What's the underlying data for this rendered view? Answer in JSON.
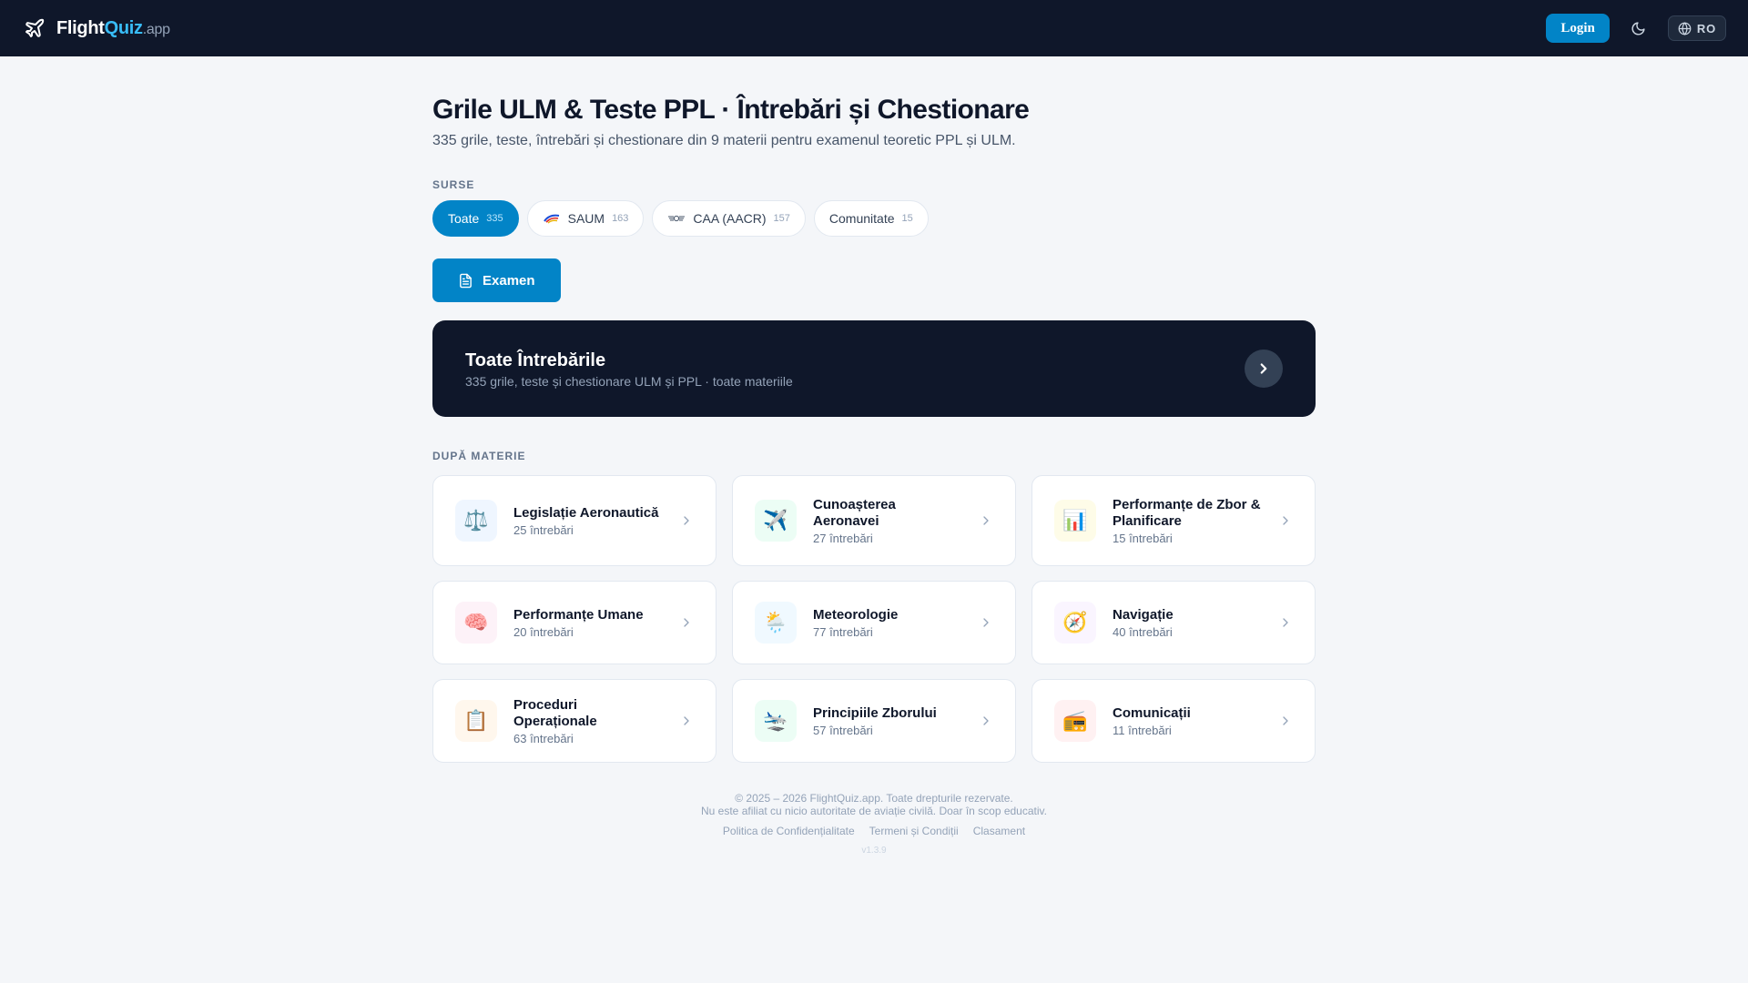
{
  "header": {
    "brand": {
      "part1": "Flight",
      "part2": "Quiz",
      "part3": ".app"
    },
    "login_label": "Login",
    "theme_icon": "moon-icon",
    "lang_label": "RO",
    "colors": {
      "bg": "#0f172a",
      "accent": "#38bdf8",
      "button": "#0284c7"
    }
  },
  "main": {
    "title": "Grile ULM & Teste PPL · Întrebări și Chestionare",
    "subtitle": "335 grile, teste, întrebări și chestionare din 9 materii pentru examenul teoretic PPL și ULM.",
    "sources_label": "SURSE",
    "sources": [
      {
        "label": "Toate",
        "count": "335",
        "active": true
      },
      {
        "label": "SAUM",
        "count": "163",
        "icon": "saum-logo"
      },
      {
        "label": "CAA (AACR)",
        "count": "157",
        "icon": "caa-wings-logo"
      },
      {
        "label": "Comunitate",
        "count": "15"
      }
    ],
    "exam_label": "Examen",
    "all_card": {
      "title": "Toate Întrebările",
      "subtitle": "335 grile, teste și chestionare ULM și PPL · toate materiile"
    },
    "subjects_label": "DUPĂ MATERIE",
    "subjects": [
      {
        "title": "Legislație Aeronautică",
        "count": "25 întrebări",
        "icon": "⚖️",
        "icon_name": "scales-icon",
        "bg": "#eff6ff"
      },
      {
        "title": "Cunoașterea Aeronavei",
        "count": "27 întrebări",
        "icon": "✈️",
        "icon_name": "airplane-icon",
        "bg": "#ecfdf5"
      },
      {
        "title": "Performanțe de Zbor & Planificare",
        "count": "15 întrebări",
        "icon": "📊",
        "icon_name": "bar-chart-icon",
        "bg": "#fefce8"
      },
      {
        "title": "Performanțe Umane",
        "count": "20 întrebări",
        "icon": "🧠",
        "icon_name": "brain-icon",
        "bg": "#fdf2f8"
      },
      {
        "title": "Meteorologie",
        "count": "77 întrebări",
        "icon": "🌦️",
        "icon_name": "weather-icon",
        "bg": "#f0f9ff"
      },
      {
        "title": "Navigație",
        "count": "40 întrebări",
        "icon": "🧭",
        "icon_name": "compass-icon",
        "bg": "#faf5ff"
      },
      {
        "title": "Proceduri Operaționale",
        "count": "63 întrebări",
        "icon": "📋",
        "icon_name": "clipboard-icon",
        "bg": "#fff7ed"
      },
      {
        "title": "Principiile Zborului",
        "count": "57 întrebări",
        "icon": "🛬",
        "icon_name": "landing-plane-icon",
        "bg": "#ecfdf5"
      },
      {
        "title": "Comunicații",
        "count": "11 întrebări",
        "icon": "📻",
        "icon_name": "radio-icon",
        "bg": "#fff1f2"
      }
    ]
  },
  "footer": {
    "copyright": "© 2025 – 2026 FlightQuiz.app. Toate drepturile rezervate.",
    "disclaimer": "Nu este afiliat cu nicio autoritate de aviație civilă. Doar în scop educativ.",
    "links": [
      "Politica de Confidențialitate",
      "Termeni și Condiții",
      "Clasament"
    ],
    "version": "v1.3.9"
  }
}
